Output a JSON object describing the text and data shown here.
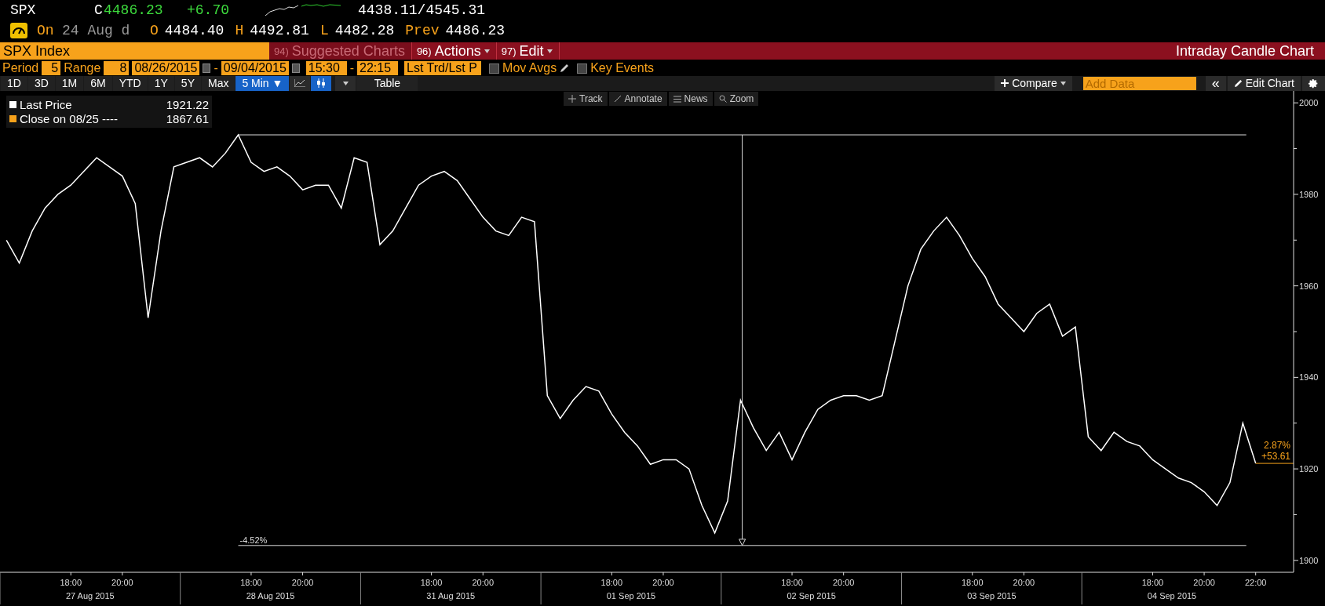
{
  "quote": {
    "ticker": "SPX",
    "close_flag": "C",
    "last": "4486.23",
    "change": "+6.70",
    "range": "4438.11/4545.31",
    "date_prefix": "On",
    "date": "24 Aug d",
    "fields": [
      {
        "label": "O",
        "value": "4484.40"
      },
      {
        "label": "H",
        "value": "4492.81"
      },
      {
        "label": "L",
        "value": "4482.28"
      },
      {
        "label": "Prev",
        "value": "4486.23"
      }
    ]
  },
  "menu_bar": {
    "security": "SPX Index",
    "title": "Intraday Candle Chart",
    "items": [
      {
        "number": "94)",
        "label": "Suggested Charts",
        "disabled": true,
        "has_menu": false
      },
      {
        "number": "96)",
        "label": "Actions",
        "disabled": false,
        "has_menu": true
      },
      {
        "number": "97)",
        "label": "Edit",
        "disabled": false,
        "has_menu": true
      }
    ]
  },
  "settings": {
    "period": {
      "label": "Period",
      "value": "5"
    },
    "range": {
      "label": "Range",
      "value": "8"
    },
    "start_date": "08/26/2015",
    "end_date": "09/04/2015",
    "date_separator": "-",
    "start_time": "15:30",
    "end_time": "22:15",
    "time_separator": "-",
    "price_mode": "Lst Trd/Lst P",
    "options": [
      {
        "label": "Mov Avgs",
        "checked": false,
        "has_edit": true
      },
      {
        "label": "Key Events",
        "checked": false,
        "has_edit": false
      }
    ]
  },
  "toolbar": {
    "ranges": [
      {
        "label": "1D",
        "selected": false
      },
      {
        "label": "3D",
        "selected": false
      },
      {
        "label": "1M",
        "selected": false
      },
      {
        "label": "6M",
        "selected": false
      },
      {
        "label": "YTD",
        "selected": false
      },
      {
        "label": "1Y",
        "selected": false
      },
      {
        "label": "5Y",
        "selected": false
      },
      {
        "label": "Max",
        "selected": false
      },
      {
        "label": "5 Min ▼",
        "selected": true
      }
    ],
    "chart_types": [
      {
        "kind": "line",
        "selected": false
      },
      {
        "kind": "candle",
        "selected": true
      }
    ],
    "table": "Table",
    "compare": "Compare",
    "add_data_placeholder": "Add Data",
    "collapse": "«",
    "edit_chart": "Edit Chart"
  },
  "chart": {
    "tools": [
      {
        "kind": "track",
        "label": "Track"
      },
      {
        "kind": "annotate",
        "label": "Annotate"
      },
      {
        "kind": "news",
        "label": "News"
      },
      {
        "kind": "zoom",
        "label": "Zoom"
      }
    ],
    "last_value": "1921.22",
    "close_reference": {
      "label": "Close on 08/25 ----",
      "value": "1867.61",
      "color": "#f7a21b"
    },
    "range_change": "-4.52%",
    "last_change_pct": "2.87%",
    "last_change": "+53.61",
    "date_labels": [
      "27 Aug 2015",
      "28 Aug 2015",
      "31 Aug 2015",
      "01 Sep 2015",
      "02 Sep 2015",
      "03 Sep 2015",
      "04 Sep 2015"
    ],
    "chart_data": {
      "type": "line",
      "ylim": [
        1897.4,
        2002.6
      ],
      "categories": [
        null,
        null,
        null,
        null,
        null,
        "18:00",
        null,
        null,
        null,
        "20:00",
        null,
        null,
        null,
        null,
        null,
        null,
        null,
        null,
        null,
        "18:00",
        null,
        null,
        null,
        "20:00",
        null,
        null,
        null,
        null,
        null,
        null,
        null,
        null,
        null,
        "18:00",
        null,
        null,
        null,
        "20:00",
        null,
        null,
        null,
        null,
        null,
        null,
        null,
        null,
        null,
        "18:00",
        null,
        null,
        null,
        "20:00",
        null,
        null,
        null,
        null,
        null,
        null,
        null,
        null,
        null,
        "18:00",
        null,
        null,
        null,
        "20:00",
        null,
        null,
        null,
        null,
        null,
        null,
        null,
        null,
        null,
        "18:00",
        null,
        null,
        null,
        "20:00",
        null,
        null,
        null,
        null,
        null,
        null,
        null,
        null,
        null,
        "18:00",
        null,
        null,
        null,
        "20:00",
        null,
        null,
        null,
        "22:00"
      ],
      "series": [
        {
          "name": "Last Price",
          "color": "#ffffff",
          "values": [
            1970,
            1965,
            1972,
            1977,
            1980,
            1982,
            1985,
            1988,
            1986,
            1984,
            1978,
            1953,
            1972,
            1986,
            1987,
            1988,
            1986,
            1989,
            1993,
            1987,
            1985,
            1986,
            1984,
            1981,
            1982,
            1982,
            1977,
            1988,
            1987,
            1969,
            1972,
            1977,
            1982,
            1984,
            1985,
            1983,
            1979,
            1975,
            1972,
            1971,
            1975,
            1974,
            1936,
            1931,
            1935,
            1938,
            1937,
            1932,
            1928,
            1925,
            1921,
            1922,
            1922,
            1920,
            1912,
            1906,
            1913,
            1935,
            1929,
            1924,
            1928,
            1922,
            1928,
            1933,
            1935,
            1936,
            1936,
            1935,
            1936,
            1948,
            1960,
            1968,
            1972,
            1975,
            1971,
            1966,
            1962,
            1956,
            1953,
            1950,
            1954,
            1956,
            1949,
            1951,
            1927,
            1924,
            1928,
            1926,
            1925,
            1922,
            1920,
            1918,
            1917,
            1915,
            1912,
            1917,
            1930,
            1921.2
          ]
        }
      ],
      "yticks": [
        1900,
        1920,
        1940,
        1960,
        1980,
        2000
      ]
    }
  }
}
